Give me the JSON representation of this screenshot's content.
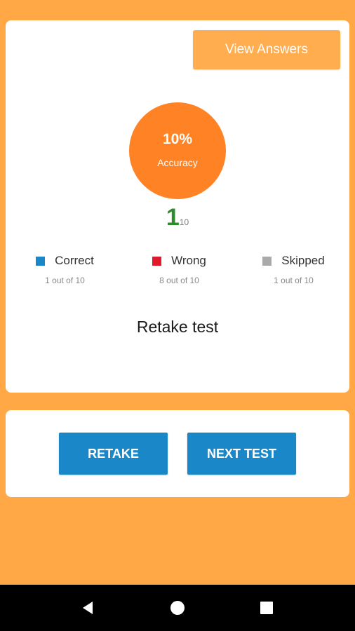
{
  "header": {
    "view_answers_label": "View Answers"
  },
  "accuracy": {
    "percent_text": "10%",
    "label": "Accuracy"
  },
  "score": {
    "correct": "1",
    "total": "10"
  },
  "legend": [
    {
      "label": "Correct",
      "detail": "1 out of 10",
      "color": "#1a87c9"
    },
    {
      "label": "Wrong",
      "detail": "8 out of 10",
      "color": "#e0192d"
    },
    {
      "label": "Skipped",
      "detail": "1 out of 10",
      "color": "#aaaaaa"
    }
  ],
  "retake_test_text": "Retake test",
  "actions": {
    "retake_label": "RETAKE",
    "next_label": "NEXT TEST"
  },
  "navigation_bar": {
    "icons": [
      "back-icon",
      "home-icon",
      "recents-icon"
    ]
  },
  "colors": {
    "background": "#ffa845",
    "accent_orange": "#ff8224",
    "button_blue": "#1a87c9",
    "score_green": "#2e8b2e"
  }
}
